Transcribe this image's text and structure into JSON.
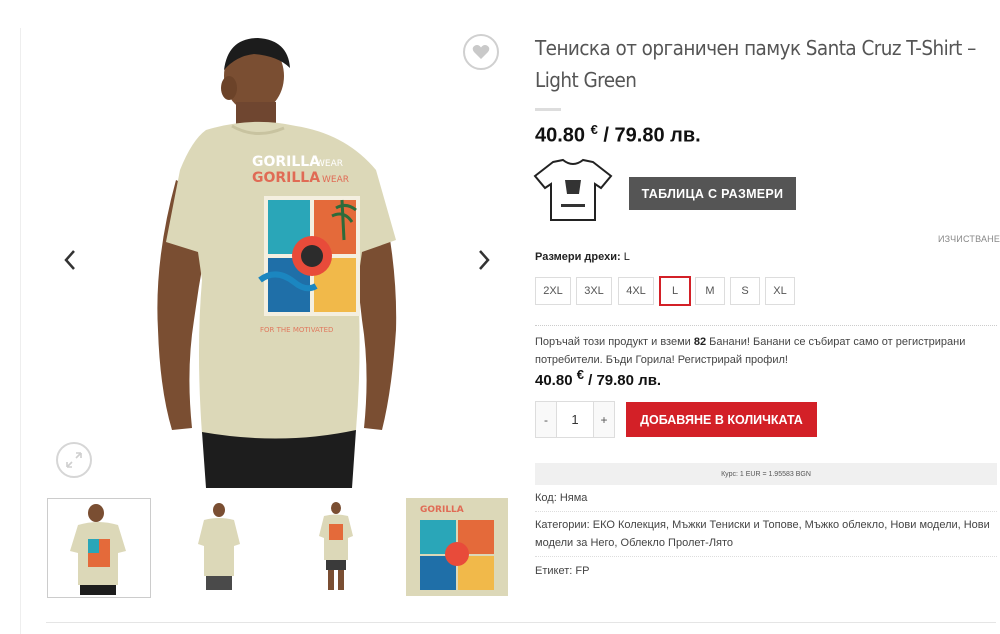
{
  "product": {
    "title": "Тениска от органичен памук Santa Cruz T-Shirt – Light Green",
    "price_main": "40.80",
    "price_main_rest": " / 79.80 лв.",
    "currency_symbol": "€",
    "size_chart_label": "ТАБЛИЦА С РАЗМЕРИ",
    "clear_label": "ИЗЧИСТВАНЕ",
    "size_label": "Размери дрехи:",
    "size_selected": "L",
    "sizes": [
      "2XL",
      "3XL",
      "4XL",
      "L",
      "M",
      "S",
      "XL"
    ],
    "promo_pre": "Поръчай този продукт и вземи ",
    "promo_count": "82",
    "promo_post": " Банани! Банани се събират само от регистрирани потребители. Бъди Горила! Регистрирай профил!",
    "price_second": "40.80",
    "price_second_rest": " / 79.80 лв.",
    "quantity": "1",
    "qty_minus": "-",
    "qty_plus": "+",
    "add_to_cart": "ДОБАВЯНЕ В КОЛИЧКАТА",
    "exchange_rate": "Курс: 1 EUR = 1.95583 BGN",
    "sku_label": "Код:",
    "sku_value": "Няма",
    "categories_label": "Категории:",
    "categories": "ЕКО Колекция, Мъжки Тениски и Топове, Мъжко облекло, Нови модели, Нови модели за Него, Облекло Пролет-Лято",
    "tag_label": "Етикет:",
    "tag_value": "FP"
  },
  "gallery": {
    "print_text_1": "GORILLA",
    "print_text_2": "WEAR",
    "print_text_3": "FOR THE MOTIVATED",
    "icons": [
      "chevron-left-icon",
      "chevron-right-icon",
      "heart-icon",
      "zoom-icon",
      "tshirt-size-icon"
    ]
  },
  "colors": {
    "accent_red": "#d32027",
    "dark_button": "#555555",
    "shirt": "#dcd8b8"
  }
}
